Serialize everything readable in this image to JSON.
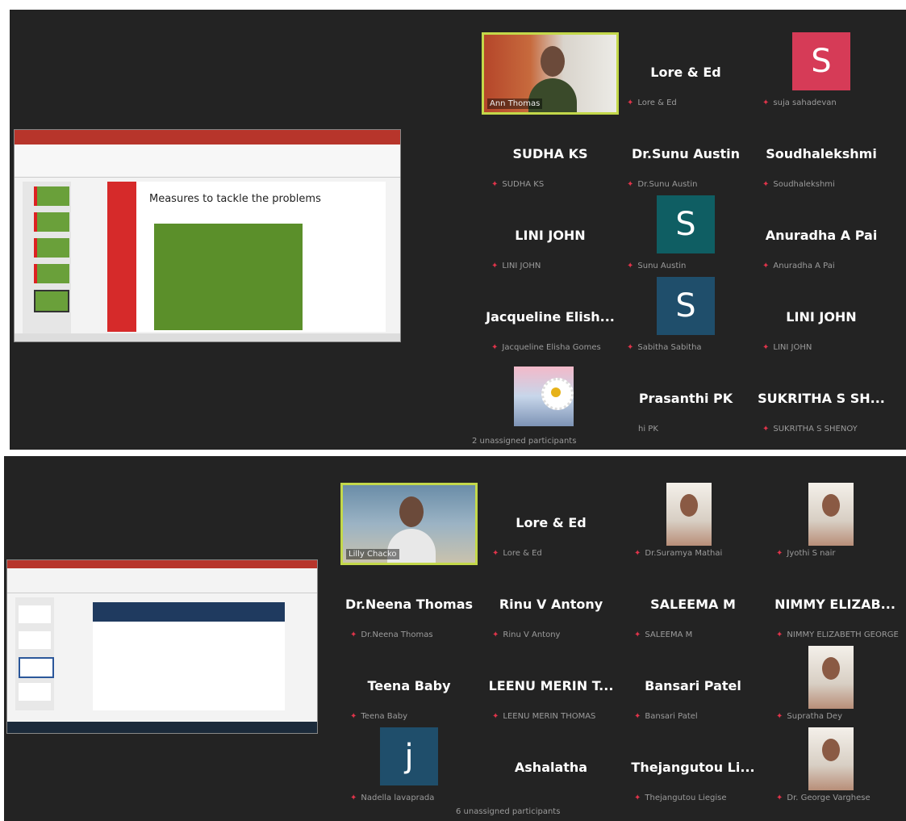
{
  "top_group": {
    "tiles": [
      {
        "name": "",
        "label": "Ann Thomas",
        "kind": "video"
      },
      {
        "name": "Lore & Ed",
        "label": "Lore & Ed"
      },
      {
        "name": "",
        "label": "suja sahadevan",
        "avatar": "S",
        "avatar_color": "#d63b57"
      },
      {
        "name": "SUDHA KS",
        "label": "SUDHA KS"
      },
      {
        "name": "Dr.Sunu Austin",
        "label": "Dr.Sunu Austin"
      },
      {
        "name": "Soudhalekshmi",
        "label": "Soudhalekshmi"
      },
      {
        "name": "LINI JOHN",
        "label": "LINI JOHN"
      },
      {
        "name": "",
        "label": "Sunu Austin",
        "avatar": "S",
        "avatar_color": "#0f5e63"
      },
      {
        "name": "Anuradha A Pai",
        "label": "Anuradha A Pai"
      },
      {
        "name": "Jacqueline  Elish...",
        "label": "Jacqueline Elisha Gomes"
      },
      {
        "name": "",
        "label": "Sabitha Sabitha",
        "avatar": "S",
        "avatar_color": "#1f4e6b"
      },
      {
        "name": "LINI JOHN",
        "label": "LINI JOHN"
      },
      {
        "name": "",
        "label": "",
        "kind": "flower"
      },
      {
        "name": "Prasanthi PK",
        "label": "hi PK",
        "nomic": true
      },
      {
        "name": "SUKRITHA S SH...",
        "label": "SUKRITHA S SHENOY"
      }
    ],
    "unassigned": "2 unassigned participants",
    "slide_title": "Measures to tackle the problems"
  },
  "bottom_group": {
    "tiles": [
      {
        "name": "",
        "label": "Lilly Chacko",
        "kind": "video"
      },
      {
        "name": "Lore & Ed",
        "label": "Lore & Ed"
      },
      {
        "name": "",
        "label": "Dr.Suramya Mathai",
        "kind": "photo"
      },
      {
        "name": "",
        "label": "Jyothi S nair",
        "kind": "photo"
      },
      {
        "name": "Dr.Neena Thomas",
        "label": "Dr.Neena Thomas"
      },
      {
        "name": "Rinu V Antony",
        "label": "Rinu V Antony"
      },
      {
        "name": "SALEEMA M",
        "label": "SALEEMA M"
      },
      {
        "name": "NIMMY  ELIZAB...",
        "label": "NIMMY ELIZABETH GEORGE"
      },
      {
        "name": "Teena Baby",
        "label": "Teena Baby"
      },
      {
        "name": "LEENU  MERIN  T...",
        "label": "LEENU MERIN THOMAS"
      },
      {
        "name": "Bansari Patel",
        "label": "Bansari Patel"
      },
      {
        "name": "",
        "label": "Supratha Dey",
        "kind": "photo"
      },
      {
        "name": "",
        "label": "Nadella lavaprada",
        "avatar": "j",
        "avatar_color": "#1f4e6b"
      },
      {
        "name": "Ashalatha",
        "label": "",
        "nomic": true
      },
      {
        "name": "Thejangutou  Li...",
        "label": "Thejangutou Liegise"
      },
      {
        "name": "",
        "label": "Dr. George Varghese",
        "kind": "photo"
      }
    ],
    "unassigned": "6 unassigned participants"
  }
}
